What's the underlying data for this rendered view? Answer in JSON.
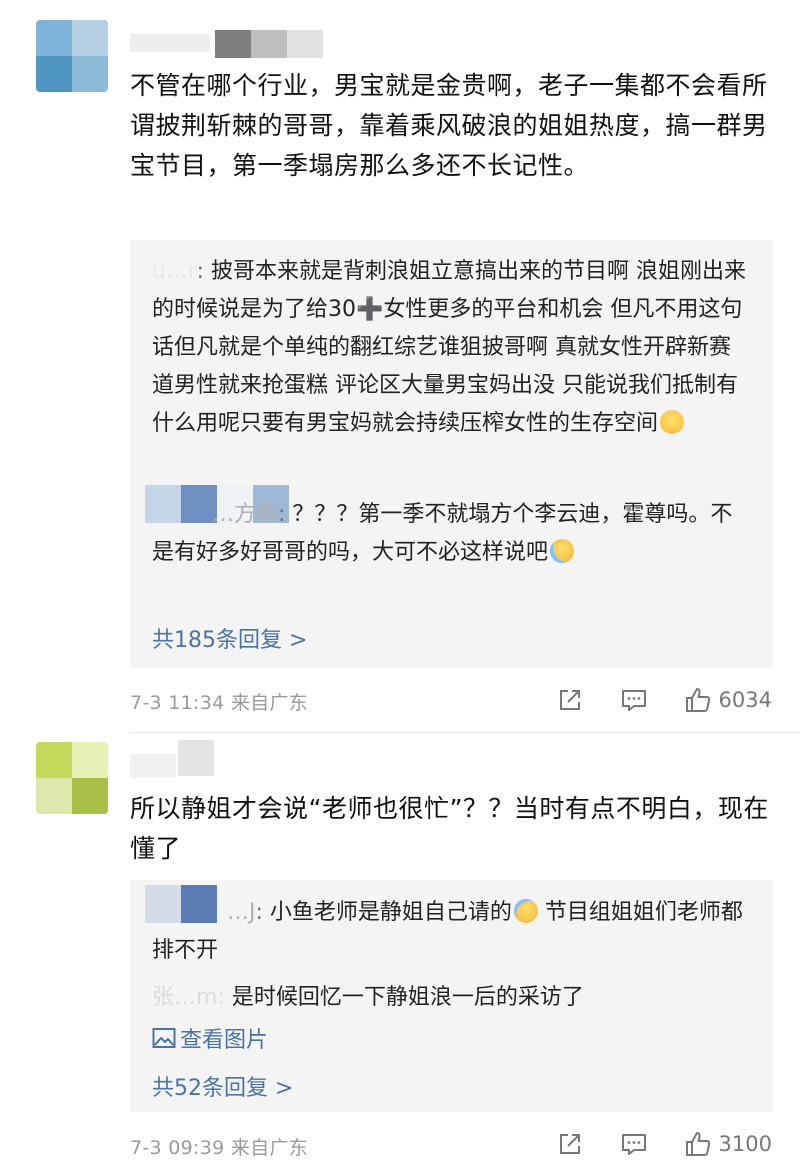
{
  "comments": [
    {
      "avatar_colors": [
        "#7fb3d9",
        "#a6c8e3",
        "#5fa0c8",
        "#8dbad6"
      ],
      "text": "不管在哪个行业，男宝就是金贵啊，老子一集都不会看所谓披荆斩棘的哥哥，靠着乘风破浪的姐姐热度，搞一群男宝节目，第一季塌房那么多还不长记性。",
      "replies": [
        {
          "user": "u…r",
          "text": "披哥本来就是背刺浪姐立意搞出来的节目啊 浪姐刚出来的时候说是为了给30➕女性更多的平台和机会 但凡不用这句话但凡就是个单纯的翻红综艺谁狙披哥啊 真就女性开辟新赛道男性就来抢蛋糕 评论区大量男宝妈出没 只能说我们抵制有什么用呢只要有男宝妈就会持续压榨女性的生存空间",
          "emoji": "smiling-face-emoji"
        },
        {
          "user": "…方森",
          "text": "？？？第一季不就塌方个李云迪，霍尊吗。不是有好多好哥哥的吗，大可不必这样说吧",
          "emoji": "sweat-face-emoji"
        }
      ],
      "more_replies": "共185条回复 >",
      "time_location": "7-3 11:34 来自广东",
      "likes": "6034"
    },
    {
      "avatar_colors": [
        "#c7dc6a",
        "#e4eda6",
        "#d8e2a0",
        "#a8c44a"
      ],
      "text": "所以静姐才会说“老师也很忙”？？当时有点不明白，现在懂了",
      "replies": [
        {
          "user": "…J",
          "text": "小鱼老师是静姐自己请的",
          "emoji": "crying-face-emoji",
          "text_after": " 节目组姐姐们老师都排不开"
        },
        {
          "user": "张…m",
          "text": "是时候回忆一下静姐浪一后的采访了"
        }
      ],
      "view_images": "查看图片",
      "more_replies": "共52条回复 >",
      "time_location": "7-3 09:39 来自广东",
      "likes": "3100"
    }
  ]
}
